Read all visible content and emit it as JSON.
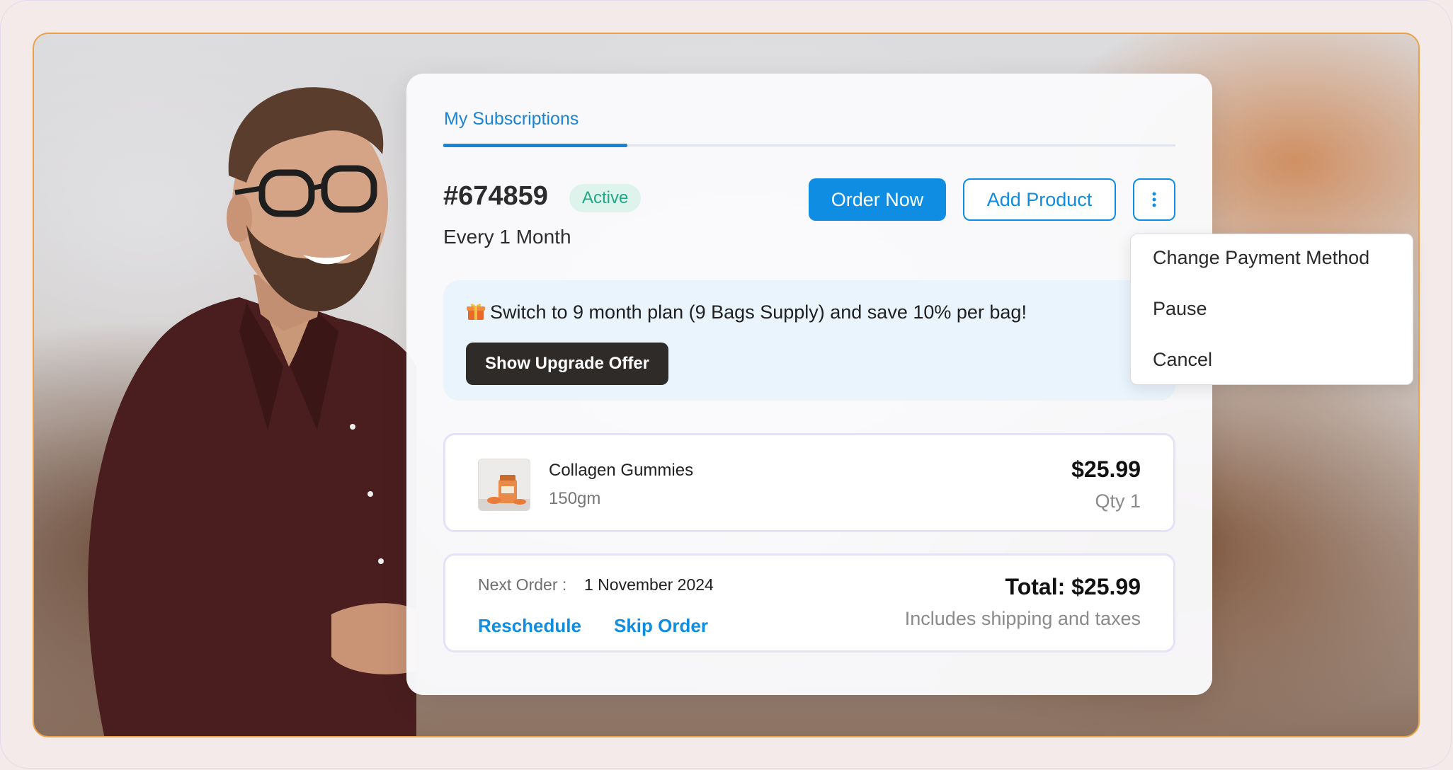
{
  "tabs": [
    {
      "label": "My Subscriptions",
      "active": true
    }
  ],
  "subscription": {
    "id": "#674859",
    "status": "Active",
    "frequency": "Every 1 Month"
  },
  "actions": {
    "order_now": "Order Now",
    "add_product": "Add Product",
    "more_icon": "vertical-dots-icon"
  },
  "promo": {
    "icon": "gift-icon",
    "text": "Switch to 9 month plan (9 Bags Supply) and save 10% per bag!",
    "button": "Show Upgrade Offer"
  },
  "product": {
    "name": "Collagen Gummies",
    "variant": "150gm",
    "price": "$25.99",
    "quantity": "Qty 1"
  },
  "order": {
    "next_label": "Next Order :",
    "next_date": "1 November 2024",
    "reschedule": "Reschedule",
    "skip": "Skip Order",
    "total": "Total: $25.99",
    "total_note": "Includes shipping and taxes"
  },
  "menu": {
    "items": [
      "Change Payment Method",
      "Pause",
      "Cancel"
    ]
  },
  "colors": {
    "accent": "#0f8de2",
    "active_badge_bg": "#ddf3ec",
    "active_badge_text": "#20a885",
    "promo_bg": "#eaf4fd",
    "frame_border": "#e9a24a"
  }
}
